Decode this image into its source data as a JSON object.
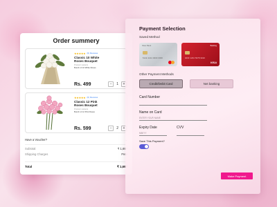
{
  "order": {
    "title": "Order summery",
    "products": [
      {
        "name": "Classic 10 White Roses Bouquet",
        "tag": "Product variants",
        "bunch": "Bunch of 10 White Roses",
        "price": "Rs. 499",
        "qty": "1",
        "rating_label": "(6) Reviews"
      },
      {
        "name": "Classic 12 Pink Roses Bouquet",
        "tag": "Product variants",
        "bunch": "Bunch of 12 Pink Roses",
        "price": "Rs. 599",
        "qty": "2",
        "rating_label": "(6) Reviews"
      }
    ],
    "voucher": "Have a Voucher?",
    "subtotal_label": "Subtotal",
    "subtotal": "₹ 1,697",
    "shipping_label": "Shipping Charges",
    "shipping": "Free",
    "total_label": "Total",
    "total": "₹ 1,697"
  },
  "payment": {
    "title": "Payment Selection",
    "saved_method": "Saved Method",
    "cards": [
      {
        "bank": "Silver Bank",
        "number": "5142 2214 0000 0000",
        "network": "mastercard"
      },
      {
        "bank": "Banking",
        "number": "4000 1234 5678 9010",
        "network": "VISA"
      }
    ],
    "other_methods": "Other Payment Methods",
    "method_card": "Credit/Debit Card",
    "method_netbanking": "Net banking",
    "card_number_label": "Card Number",
    "name_label": "Name on Card",
    "name_placeholder": "ENTER YOUR NAME",
    "expiry_label": "Expiry Date",
    "expiry_placeholder": "MM/YY",
    "cvv_label": "CVV",
    "save_label": "Save This Payment?",
    "make_payment": "Make Payment"
  },
  "colors": {
    "accent": "#f0188d",
    "toggle": "#5b5bd6"
  }
}
